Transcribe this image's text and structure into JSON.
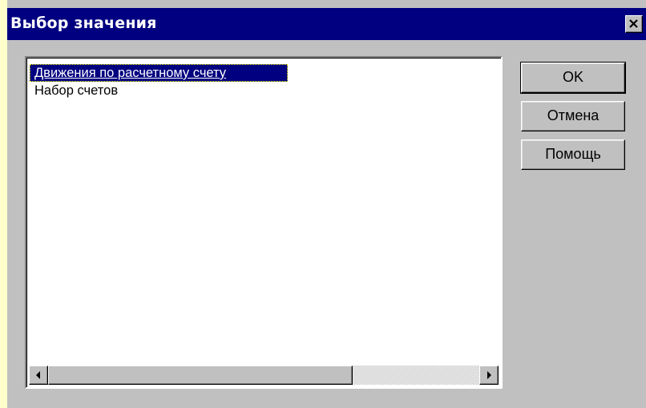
{
  "dialog": {
    "title": "Выбор значения",
    "close_icon": "close-icon"
  },
  "list": {
    "items": [
      {
        "label": "Движения по расчетному счету",
        "selected": true
      },
      {
        "label": "Набор счетов",
        "selected": false
      }
    ]
  },
  "scrollbar": {
    "left_icon": "arrow-left-icon",
    "right_icon": "arrow-right-icon"
  },
  "buttons": {
    "ok_label": "OK",
    "cancel_label": "Отмена",
    "help_label": "Помощь"
  },
  "colors": {
    "background": "#ffffcc",
    "titlebar": "#000080",
    "face": "#c0c0c0",
    "selection": "#000080"
  }
}
